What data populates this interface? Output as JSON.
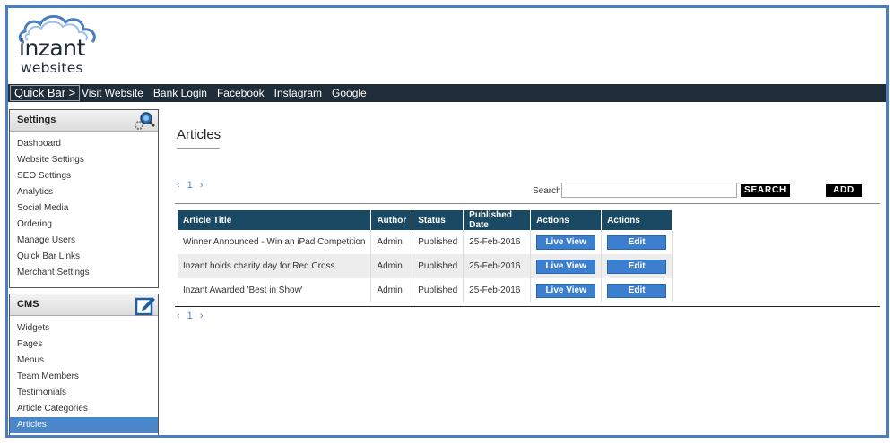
{
  "header": {
    "brand": "inzant",
    "brand_sub": "websites"
  },
  "quickbar": {
    "label": "Quick Bar >",
    "links": [
      "Visit Website",
      "Bank Login",
      "Facebook",
      "Instagram",
      "Google"
    ]
  },
  "sidebar": {
    "settings": {
      "title": "Settings",
      "icon": "gear-search-icon",
      "items": [
        "Dashboard",
        "Website Settings",
        "SEO Settings",
        "Analytics",
        "Social Media",
        "Ordering",
        "Manage Users",
        "Quick Bar Links",
        "Merchant Settings"
      ]
    },
    "cms": {
      "title": "CMS",
      "icon": "edit-icon",
      "items": [
        "Widgets",
        "Pages",
        "Menus",
        "Team Members",
        "Testimonials",
        "Article Categories",
        "Articles"
      ],
      "active": "Articles"
    }
  },
  "main": {
    "title": "Articles",
    "pager": {
      "prev": "‹",
      "page": "1",
      "next": "›"
    },
    "search_label": "Search",
    "search_value": "",
    "search_button": "SEARCH",
    "add_button": "ADD",
    "table": {
      "headers": [
        "Article Title",
        "Author",
        "Status",
        "Published Date",
        "Actions",
        "Actions"
      ],
      "rows": [
        {
          "title": "Winner Announced - Win an iPad Competition",
          "author": "Admin",
          "status": "Published",
          "date": "25-Feb-2016",
          "live": "Live View",
          "edit": "Edit"
        },
        {
          "title": "Inzant holds charity day for Red Cross",
          "author": "Admin",
          "status": "Published",
          "date": "25-Feb-2016",
          "live": "Live View",
          "edit": "Edit"
        },
        {
          "title": "Inzant Awarded 'Best in Show'",
          "author": "Admin",
          "status": "Published",
          "date": "25-Feb-2016",
          "live": "Live View",
          "edit": "Edit"
        }
      ]
    }
  },
  "colors": {
    "frame": "#4a7ebf",
    "quickbar": "#1f2d3a",
    "table_header": "#1a4a63",
    "button_blue": "#3d7fcf",
    "active_item": "#4a86c8"
  }
}
